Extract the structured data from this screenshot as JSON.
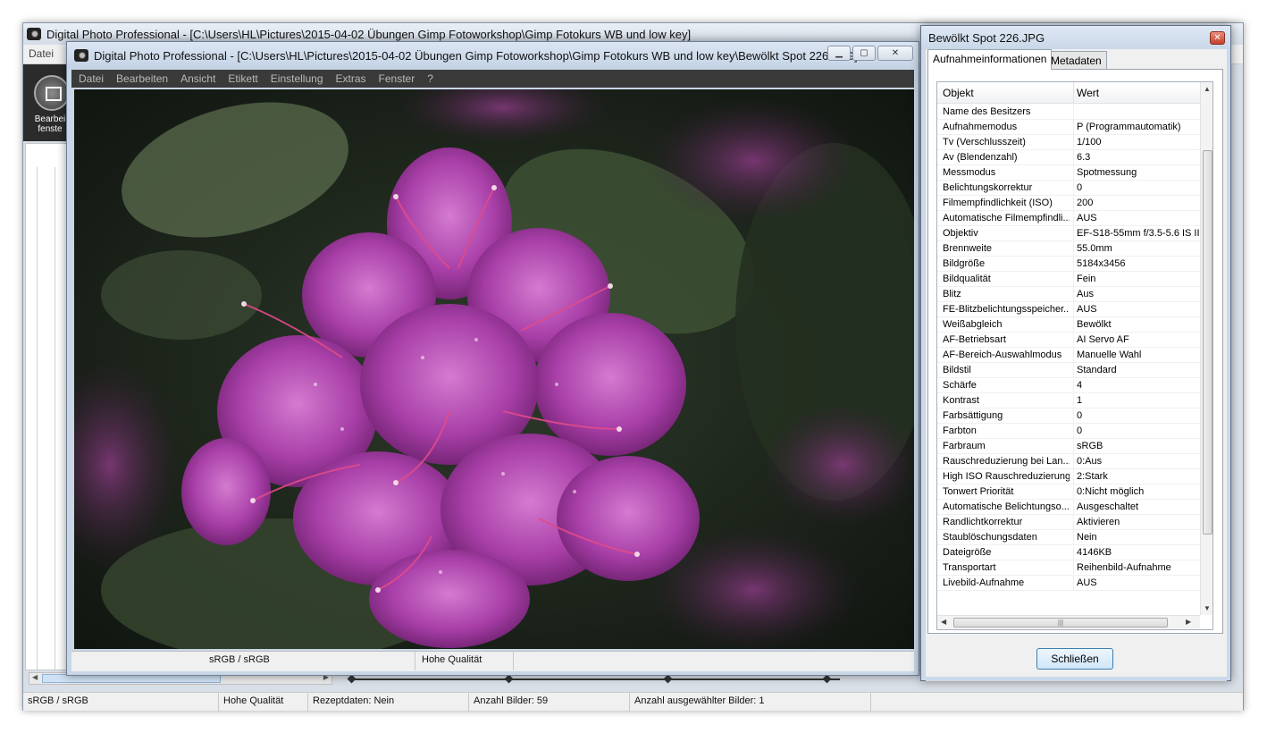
{
  "main_window": {
    "title": "Digital Photo Professional - [C:\\Users\\HL\\Pictures\\2015-04-02 Übungen  Gimp Fotoworkshop\\Gimp Fotokurs WB und low key]",
    "menu_first": "Datei",
    "toolbar_label": "Bearbei fenste",
    "status": {
      "color_space": "sRGB / sRGB",
      "quality": "Hohe Qualität",
      "recipe": "Rezeptdaten: Nein",
      "image_count": "Anzahl Bilder: 59",
      "selected_count": "Anzahl ausgewählter Bilder: 1"
    }
  },
  "viewer": {
    "title": "Digital Photo Professional - [C:\\Users\\HL\\Pictures\\2015-04-02 Übungen  Gimp Fotoworkshop\\Gimp Fotokurs WB und low key\\Bewölkt Spot 226.JPG]",
    "menu": [
      "Datei",
      "Bearbeiten",
      "Ansicht",
      "Etikett",
      "Einstellung",
      "Extras",
      "Fenster",
      "?"
    ],
    "status": {
      "color_space": "sRGB / sRGB",
      "quality": "Hohe Qualität"
    },
    "photo_icon": "rhododendron-flower-photo"
  },
  "dialog": {
    "title": "Bewölkt Spot 226.JPG",
    "tabs": [
      "Aufnahmeinformationen",
      "Metadaten"
    ],
    "columns": [
      "Objekt",
      "Wert"
    ],
    "rows": [
      [
        "Name des Besitzers",
        ""
      ],
      [
        "Aufnahmemodus",
        "P (Programmautomatik)"
      ],
      [
        "Tv (Verschlusszeit)",
        "1/100"
      ],
      [
        "Av (Blendenzahl)",
        "6.3"
      ],
      [
        "Messmodus",
        "Spotmessung"
      ],
      [
        "Belichtungskorrektur",
        "0"
      ],
      [
        "Filmempfindlichkeit (ISO)",
        "200"
      ],
      [
        "Automatische Filmempfindli...",
        "AUS"
      ],
      [
        "Objektiv",
        "EF-S18-55mm f/3.5-5.6 IS II"
      ],
      [
        "Brennweite",
        "55.0mm"
      ],
      [
        "Bildgröße",
        "5184x3456"
      ],
      [
        "Bildqualität",
        "Fein"
      ],
      [
        "Blitz",
        "Aus"
      ],
      [
        "FE-Blitzbelichtungsspeicher...",
        "AUS"
      ],
      [
        "Weißabgleich",
        "Bewölkt"
      ],
      [
        "AF-Betriebsart",
        "AI Servo AF"
      ],
      [
        "AF-Bereich-Auswahlmodus",
        "Manuelle  Wahl"
      ],
      [
        "Bildstil",
        "Standard"
      ],
      [
        "Schärfe",
        "4"
      ],
      [
        "Kontrast",
        "1"
      ],
      [
        "Farbsättigung",
        "0"
      ],
      [
        "Farbton",
        "0"
      ],
      [
        "Farbraum",
        "sRGB"
      ],
      [
        "Rauschreduzierung bei Lan...",
        "0:Aus"
      ],
      [
        "High ISO Rauschreduzierung",
        "2:Stark"
      ],
      [
        "Tonwert Priorität",
        "0:Nicht möglich"
      ],
      [
        "Automatische Belichtungso...",
        "Ausgeschaltet"
      ],
      [
        "Randlichtkorrektur",
        "Aktivieren"
      ],
      [
        "Staublöschungsdaten",
        "Nein"
      ],
      [
        "Dateigröße",
        "4146KB"
      ],
      [
        "Transportart",
        "Reihenbild-Aufnahme"
      ],
      [
        "Livebild-Aufnahme",
        "AUS"
      ]
    ],
    "close_button": "Schließen"
  },
  "colors": {
    "titlebar": "#d4dde8",
    "viewer_menubar": "#3a3a3a",
    "button_border": "#3c7fb1",
    "close_red": "#c4422e"
  }
}
